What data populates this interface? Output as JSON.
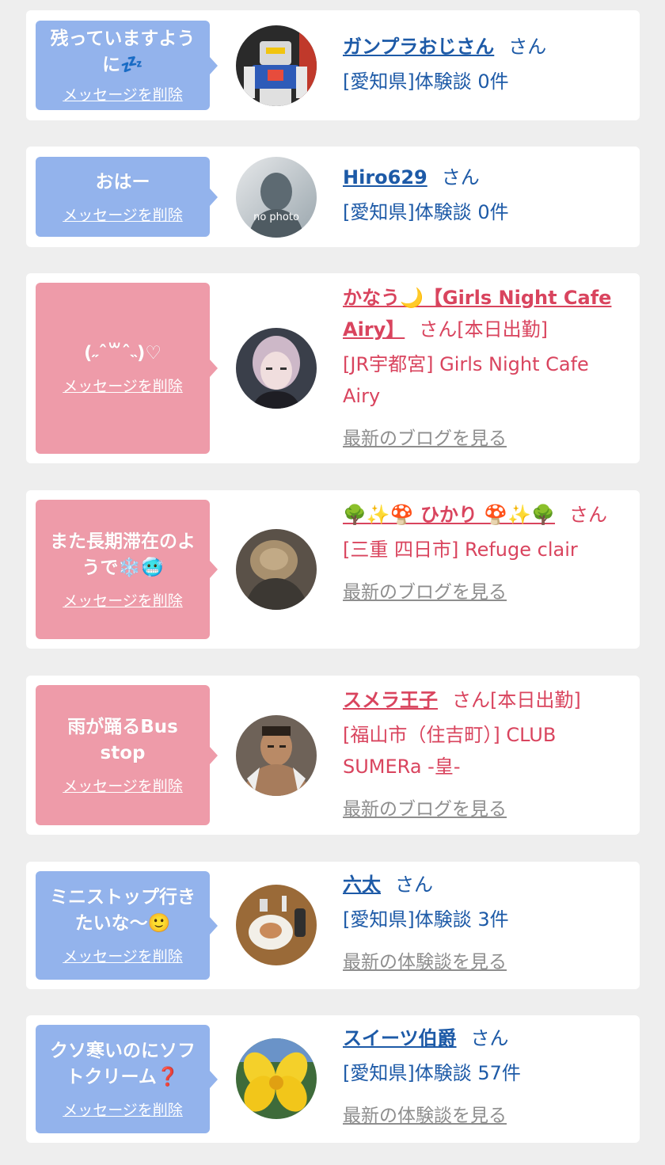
{
  "messages": [
    {
      "bubble_text": "残っていますように💤",
      "delete_label": "メッセージを削除",
      "user_name": "ガンプラおじさん",
      "suffix": "さん",
      "location": "[愛知県]体験談 0件",
      "link": "",
      "color": "#93b3ec"
    },
    {
      "bubble_text": "おはー",
      "delete_label": "メッセージを削除",
      "user_name": "Hiro629",
      "suffix": "さん",
      "location": "[愛知県]体験談 0件",
      "link": "",
      "avatar_text": "no photo",
      "color": "#93b3ec"
    },
    {
      "bubble_text": "(˶ˆ꒳ˆ˵)♡",
      "delete_label": "メッセージを削除",
      "user_name": "かなう🌙【Girls Night Cafe Airy】",
      "suffix": "さん[本日出勤]",
      "location": "[JR宇都宮] Girls Night Cafe Airy",
      "link": "最新のブログを見る",
      "color": "#ee9ba9"
    },
    {
      "bubble_text": "また長期滞在のようで❄️🥶",
      "delete_label": "メッセージを削除",
      "user_name": "🌳✨🍄 ひかり 🍄✨🌳",
      "suffix": "さん",
      "location": "[三重 四日市] Refuge clair",
      "link": "最新のブログを見る",
      "color": "#ee9ba9"
    },
    {
      "bubble_text": "雨が踊るBus stop",
      "delete_label": "メッセージを削除",
      "user_name": "スメラ王子",
      "suffix": "さん[本日出勤]",
      "location": "[福山市（住吉町）] CLUB SUMERa -皇-",
      "link": "最新のブログを見る",
      "color": "#ee9ba9"
    },
    {
      "bubble_text": "ミニストップ行きたいな〜🙂",
      "delete_label": "メッセージを削除",
      "user_name": "六太",
      "suffix": "さん",
      "location": "[愛知県]体験談 3件",
      "link": "最新の体験談を見る",
      "color": "#93b3ec"
    },
    {
      "bubble_text": "クソ寒いのにソフトクリーム❓",
      "delete_label": "メッセージを削除",
      "user_name": "スイーツ伯爵",
      "suffix": "さん",
      "location": "[愛知県]体験談 57件",
      "link": "最新の体験談を見る",
      "color": "#93b3ec"
    }
  ]
}
